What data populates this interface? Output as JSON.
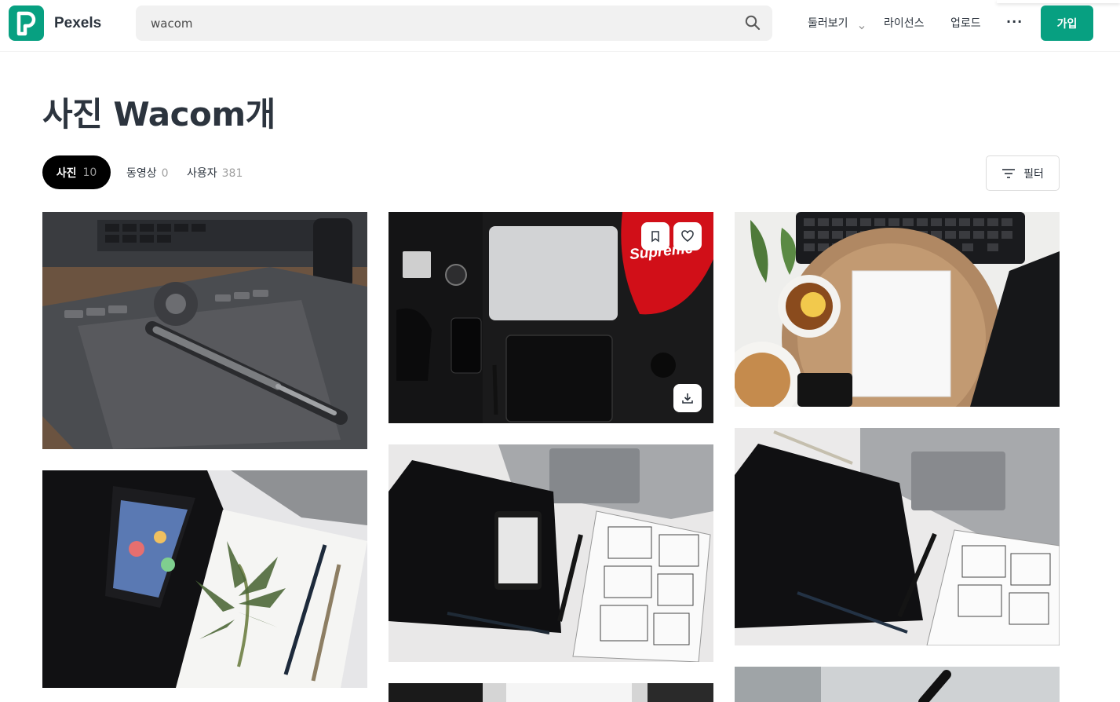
{
  "header": {
    "logo_text": "Pexels",
    "search_value": "wacom",
    "nav": {
      "explore": "둘러보기",
      "license": "라이선스",
      "upload": "업로드",
      "more": "···"
    },
    "join_label": "가입"
  },
  "page": {
    "title": "사진 Wacom개"
  },
  "tabs": [
    {
      "label": "사진",
      "count": "10"
    },
    {
      "label": "동영상",
      "count": "0"
    },
    {
      "label": "사용자",
      "count": "381"
    }
  ],
  "filter_label": "필터",
  "photos": {
    "supreme_text": "Supreme"
  },
  "colors": {
    "brand": "#07a081",
    "text": "#2c343e",
    "tab_active_bg": "#000000"
  },
  "icons": [
    "pexels-logo-icon",
    "search-icon",
    "chevron-down-icon",
    "filter-icon",
    "bookmark-icon",
    "heart-icon",
    "download-icon"
  ]
}
